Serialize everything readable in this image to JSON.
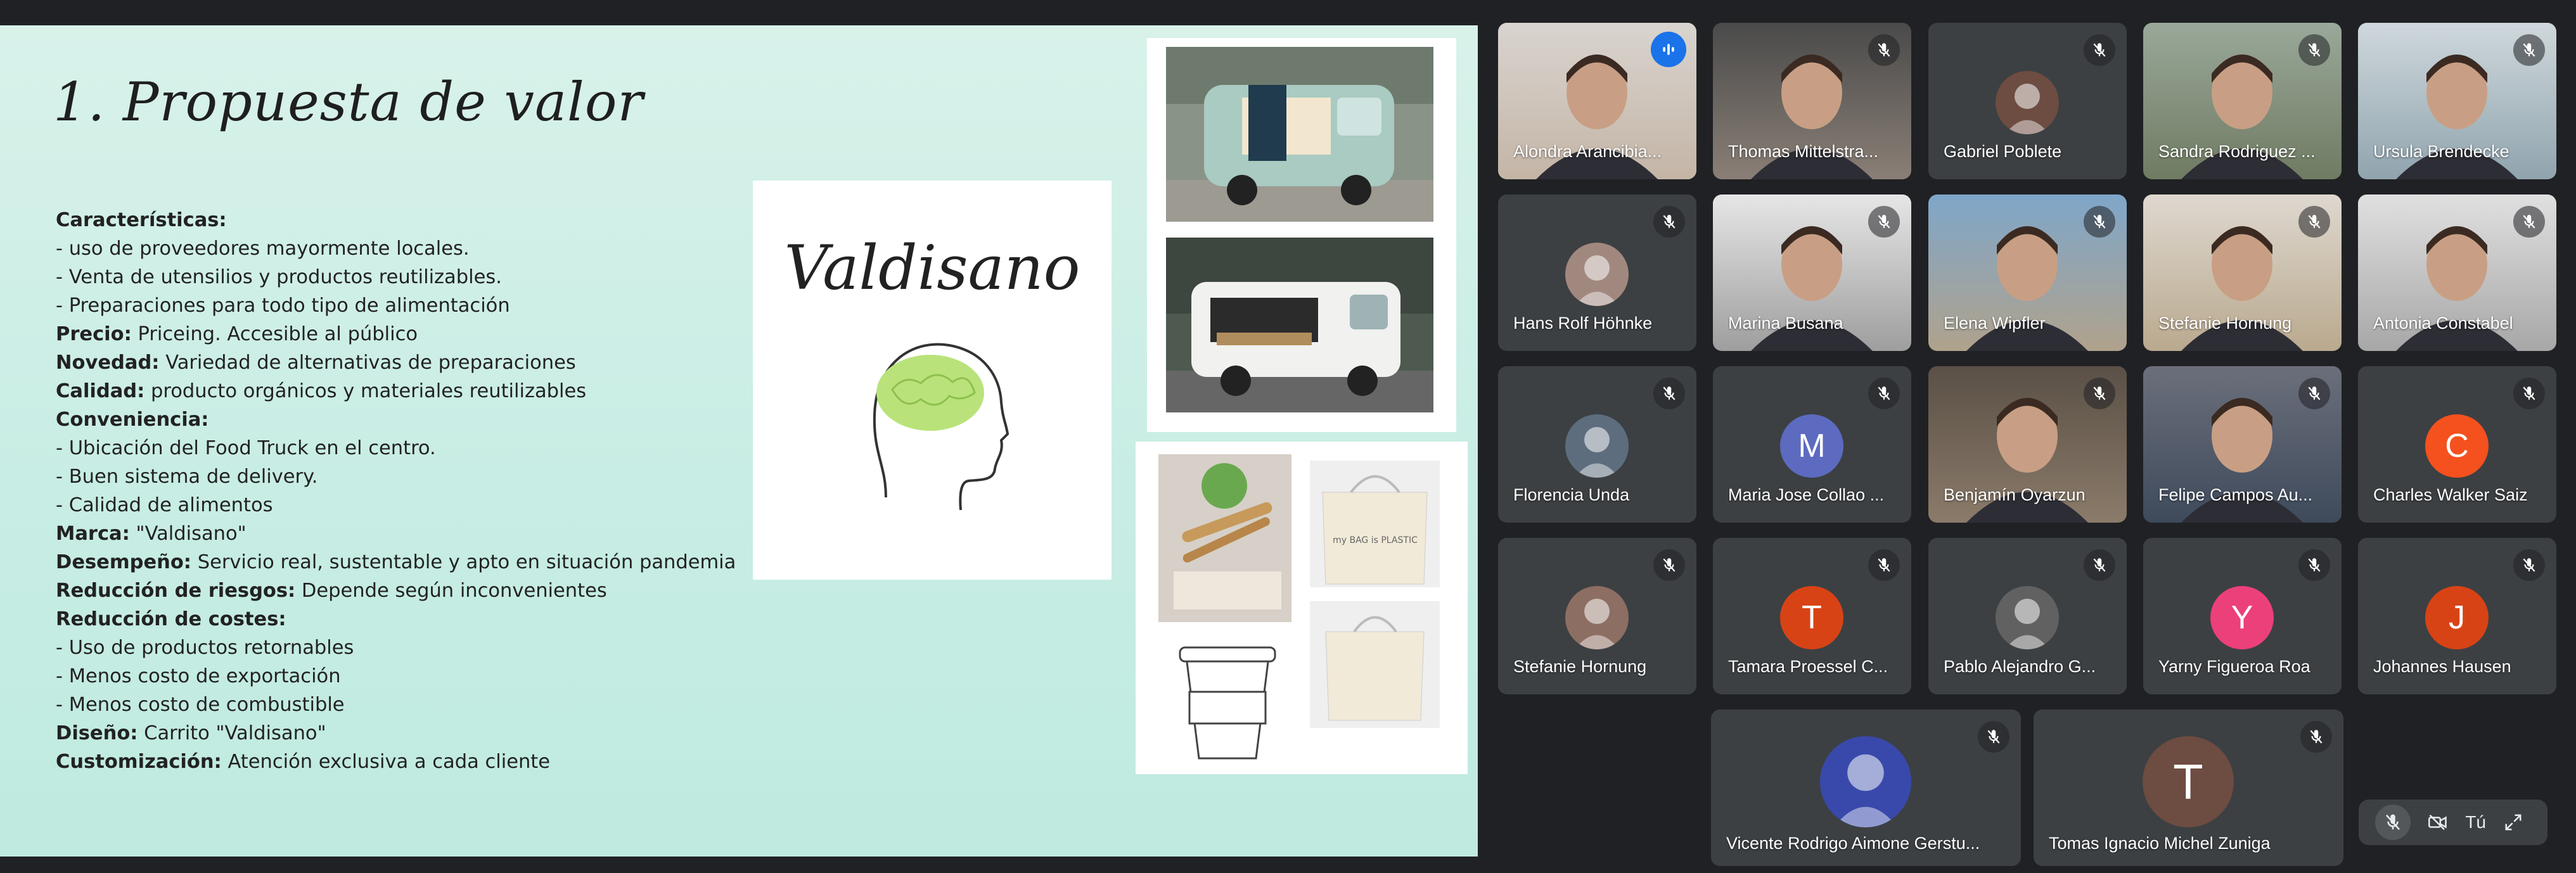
{
  "slide": {
    "title": "1.  Propuesta de valor",
    "logo_text": "Valdisano",
    "lines": [
      {
        "label": "Características:",
        "text": ""
      },
      {
        "label": "",
        "text": "- uso de proveedores mayormente locales."
      },
      {
        "label": "",
        "text": "- Venta de utensilios y productos reutilizables."
      },
      {
        "label": "",
        "text": "- Preparaciones para todo tipo de alimentación"
      },
      {
        "label": "Precio:",
        "text": " Priceing. Accesible al público"
      },
      {
        "label": "Novedad:",
        "text": " Variedad de alternativas de preparaciones"
      },
      {
        "label": "Calidad:",
        "text": " producto orgánicos y materiales reutilizables"
      },
      {
        "label": "Conveniencia:",
        "text": ""
      },
      {
        "label": "",
        "text": "- Ubicación del Food Truck en el centro."
      },
      {
        "label": "",
        "text": "- Buen sistema de delivery."
      },
      {
        "label": "",
        "text": "- Calidad de alimentos"
      },
      {
        "label": "Marca:",
        "text": " \"Valdisano\""
      },
      {
        "label": "Desempeño:",
        "text": " Servicio real, sustentable y apto en situación pandemia"
      },
      {
        "label": "Reducción de riesgos:",
        "text": " Depende según inconvenientes"
      },
      {
        "label": "Reducción de costes:",
        "text": ""
      },
      {
        "label": "",
        "text": "- Uso de productos retornables"
      },
      {
        "label": "",
        "text": "- Menos costo de exportación"
      },
      {
        "label": "",
        "text": "- Menos costo de combustible"
      },
      {
        "label": "Diseño:",
        "text": " Carrito \"Valdisano\""
      },
      {
        "label": "Customización:",
        "text": " Atención exclusiva a cada cliente"
      }
    ],
    "bag_text": "my BAG is PLASTIC"
  },
  "participants": [
    {
      "name": "Alondra Arancibia...",
      "avatar": "",
      "color": "",
      "speaking": true
    },
    {
      "name": "Thomas Mittelstra...",
      "avatar": "",
      "color": ""
    },
    {
      "name": "Gabriel Poblete",
      "avatar": "",
      "color": "#6d4c41"
    },
    {
      "name": "Sandra Rodriguez ...",
      "avatar": "",
      "color": ""
    },
    {
      "name": "Ursula Brendecke",
      "avatar": "",
      "color": ""
    },
    {
      "name": "Hans Rolf Höhnke",
      "avatar": "",
      "color": "#a1887f"
    },
    {
      "name": "Marina Busana",
      "avatar": "",
      "color": ""
    },
    {
      "name": "Elena Wipfler",
      "avatar": "",
      "color": ""
    },
    {
      "name": "Stefanie Hornung",
      "avatar": "",
      "color": ""
    },
    {
      "name": "Antonia Constabel",
      "avatar": "",
      "color": ""
    },
    {
      "name": "Florencia Unda",
      "avatar": "",
      "color": "#5d6d7e"
    },
    {
      "name": "Maria Jose Collao ...",
      "avatar": "M",
      "color": "#5c6bc0"
    },
    {
      "name": "Benjamín Oyarzun",
      "avatar": "",
      "color": ""
    },
    {
      "name": "Felipe Campos Au...",
      "avatar": "",
      "color": ""
    },
    {
      "name": "Charles Walker Saiz",
      "avatar": "C",
      "color": "#f4511e"
    },
    {
      "name": "Stefanie Hornung",
      "avatar": "",
      "color": "#8d6e63"
    },
    {
      "name": "Tamara Proessel C...",
      "avatar": "T",
      "color": "#d84315"
    },
    {
      "name": "Pablo Alejandro G...",
      "avatar": "",
      "color": "#616161"
    },
    {
      "name": "Yarny Figueroa Roa",
      "avatar": "Y",
      "color": "#ec407a"
    },
    {
      "name": "Johannes Hausen",
      "avatar": "J",
      "color": "#d84315"
    },
    {
      "name": "Vicente Rodrigo Aimone Gerstu...",
      "avatar": "",
      "color": "#3949ab"
    },
    {
      "name": "Tomas Ignacio Michel Zuniga",
      "avatar": "T",
      "color": "#6d4c41"
    }
  ],
  "controls": {
    "you_label": "Tú"
  },
  "colors": {
    "speaking_border": "#8ab4f8",
    "tile_bg": "#3c4043",
    "page_bg": "#202124"
  }
}
